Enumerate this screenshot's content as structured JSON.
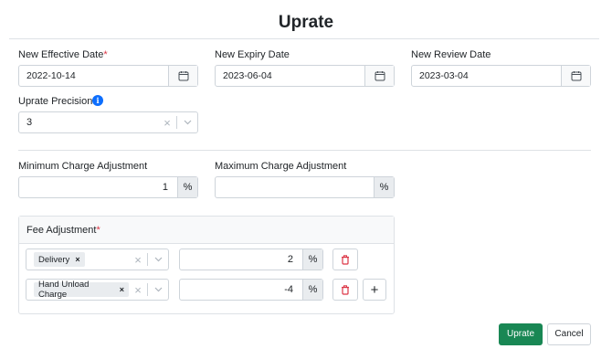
{
  "page": {
    "title": "Uprate"
  },
  "fields": {
    "effective_date": {
      "label": "New Effective Date",
      "required_mark": "*",
      "value": "2022-10-14"
    },
    "expiry_date": {
      "label": "New Expiry Date",
      "value": "2023-06-04"
    },
    "review_date": {
      "label": "New Review Date",
      "value": "2023-03-04"
    },
    "precision": {
      "label": "Uprate Precision",
      "required_mark": "*",
      "info": "i",
      "value": "3",
      "clear": "×"
    },
    "min_charge": {
      "label": "Minimum Charge Adjustment",
      "value": "1",
      "unit": "%"
    },
    "max_charge": {
      "label": "Maximum Charge Adjustment",
      "value": "",
      "unit": "%"
    }
  },
  "fee_adjustment": {
    "title": "Fee Adjustment",
    "required_mark": "*",
    "rows": [
      {
        "tag": "Delivery",
        "tag_remove": "×",
        "clear": "×",
        "value": "2",
        "unit": "%"
      },
      {
        "tag": "Hand Unload Charge",
        "tag_remove": "×",
        "clear": "×",
        "value": "-4",
        "unit": "%"
      }
    ],
    "add_label": "+"
  },
  "actions": {
    "submit": "Uprate",
    "cancel": "Cancel"
  },
  "colors": {
    "primary": "#198754",
    "danger": "#dc3545",
    "info": "#0d6efd"
  }
}
